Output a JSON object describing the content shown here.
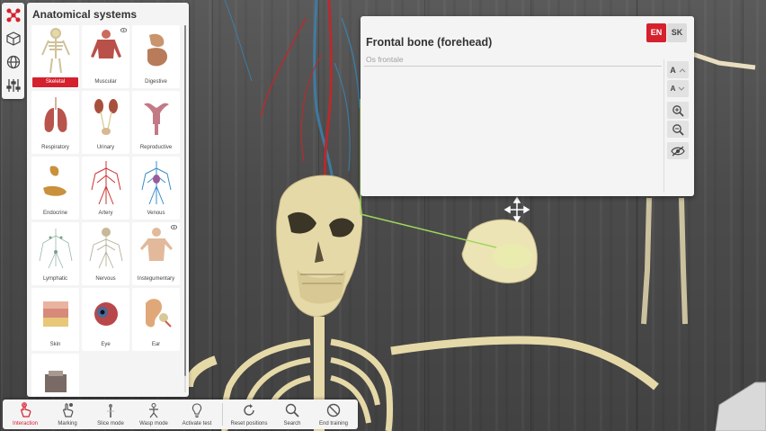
{
  "colors": {
    "accent": "#d5212e",
    "panel": "#f4f4f4",
    "bone": "#e6d9a8"
  },
  "left_toolbar": {
    "icons": [
      "systems-network-icon",
      "cube-icon",
      "globe-icon",
      "sliders-icon"
    ]
  },
  "systems_panel": {
    "title": "Anatomical systems",
    "items": [
      {
        "label": "Skeletal",
        "active": true
      },
      {
        "label": "Muscular",
        "hidden_icon": true
      },
      {
        "label": "Digestive"
      },
      {
        "label": "Respiratory"
      },
      {
        "label": "Urinary"
      },
      {
        "label": "Reproductive"
      },
      {
        "label": "Endocrine"
      },
      {
        "label": "Artery"
      },
      {
        "label": "Venous"
      },
      {
        "label": "Lymphatic"
      },
      {
        "label": "Nervous"
      },
      {
        "label": "Instegumentary",
        "hidden_icon": true
      },
      {
        "label": "Skin"
      },
      {
        "label": "Eye"
      },
      {
        "label": "Ear"
      },
      {
        "label": ""
      }
    ]
  },
  "info_card": {
    "title": "Frontal bone (forehead)",
    "latin": "Os frontale",
    "languages": [
      "EN",
      "SK"
    ],
    "active_language": "EN",
    "font_increase": "A",
    "font_decrease": "A"
  },
  "bottom_toolbar": {
    "items": [
      {
        "label": "Interaction",
        "icon": "hand-pointer-icon",
        "active": true
      },
      {
        "label": "Marking",
        "icon": "hand-mark-icon"
      },
      {
        "label": "Slice mode",
        "icon": "slice-icon"
      },
      {
        "label": "Wasp mode",
        "icon": "wasp-icon"
      },
      {
        "label": "Activate test",
        "icon": "lightbulb-icon"
      },
      {
        "label": "Reset positions",
        "icon": "reset-icon"
      },
      {
        "label": "Search",
        "icon": "search-icon"
      },
      {
        "label": "End training",
        "icon": "no-entry-icon"
      }
    ]
  }
}
